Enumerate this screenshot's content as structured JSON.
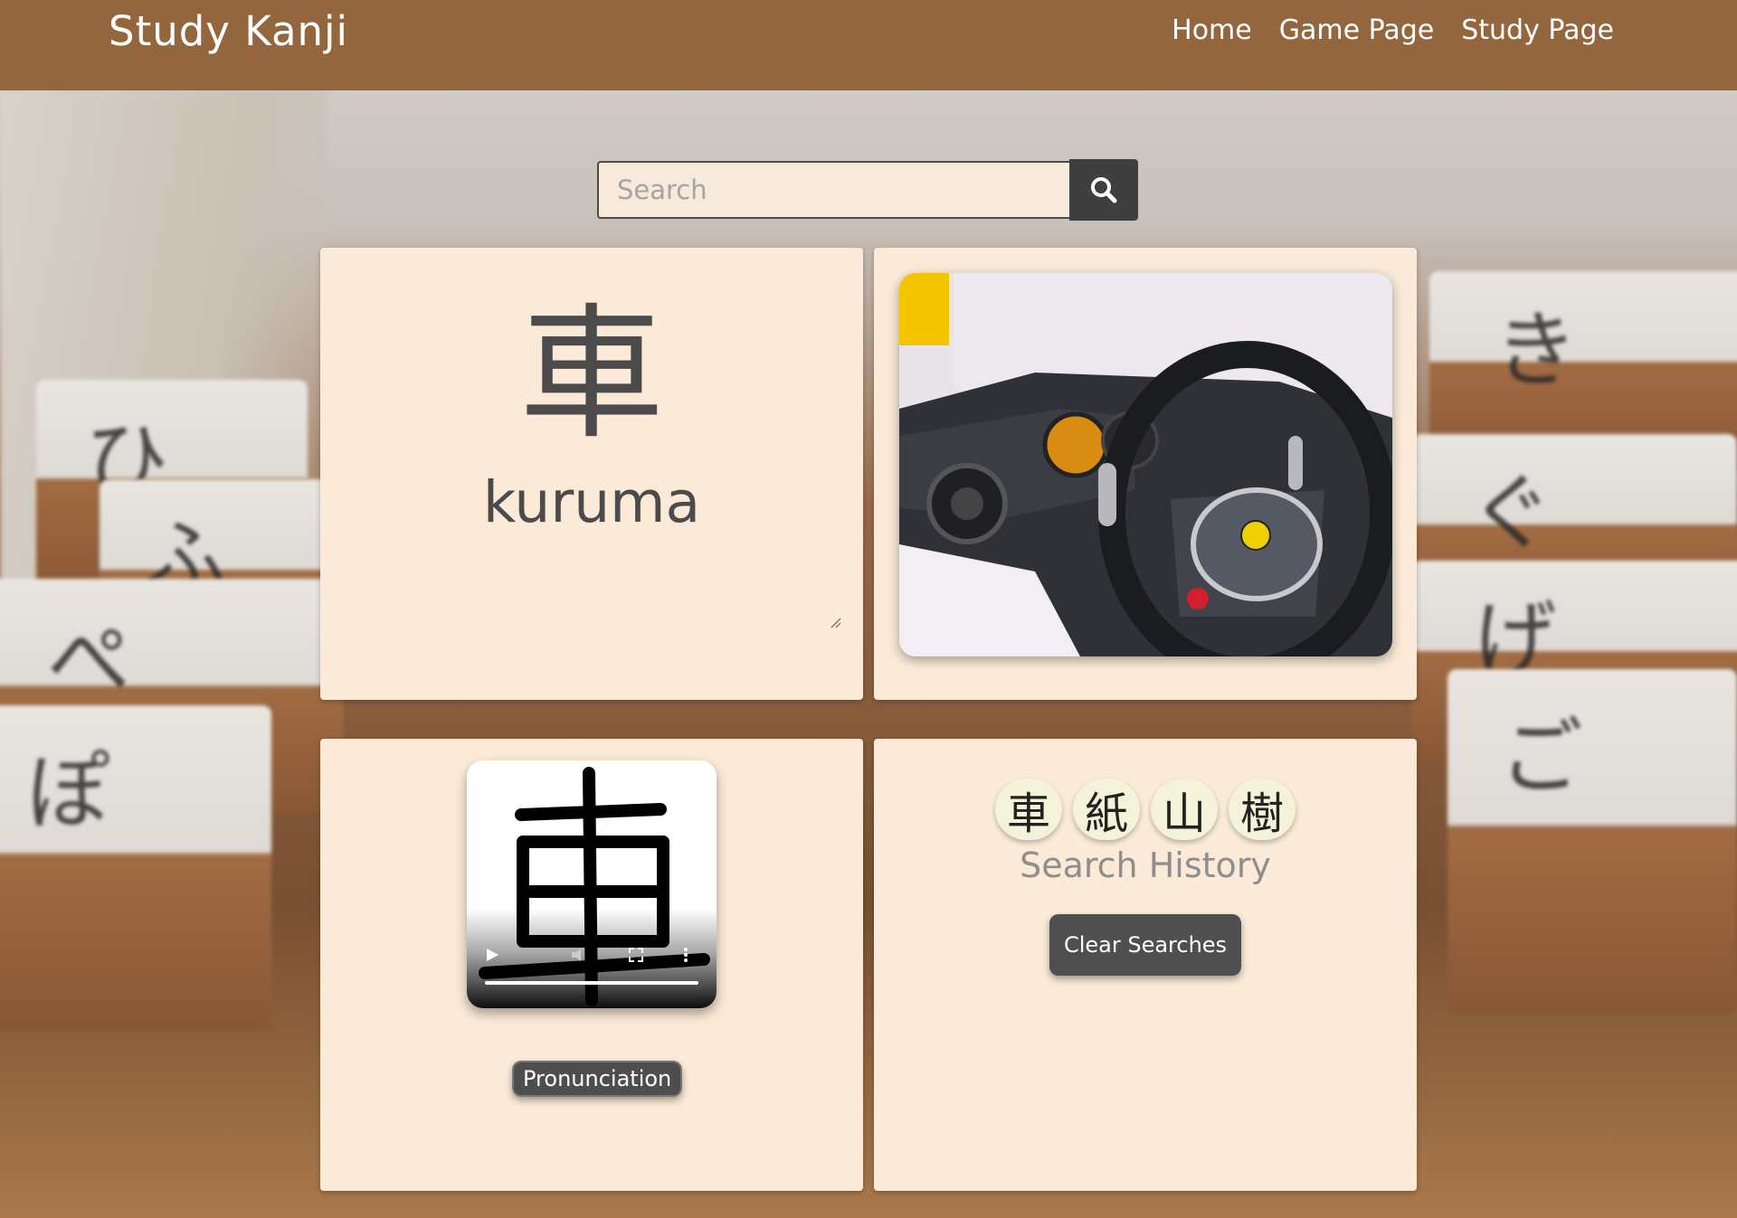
{
  "header": {
    "brand": "Study Kanji",
    "nav": [
      "Home",
      "Game Page",
      "Study Page"
    ]
  },
  "search": {
    "placeholder": "Search",
    "value": ""
  },
  "kanji_card": {
    "character": "車",
    "reading": "kuruma"
  },
  "image_card": {
    "alt": "Car interior with steering wheel"
  },
  "stroke_card": {
    "character": "車",
    "button_label": "Pronunciation"
  },
  "history_card": {
    "items": [
      "車",
      "紙",
      "山",
      "樹"
    ],
    "title": "Search History",
    "clear_label": "Clear Searches"
  },
  "colors": {
    "header": "#94663d",
    "card": "#faead7",
    "button": "#4f4f4f"
  }
}
